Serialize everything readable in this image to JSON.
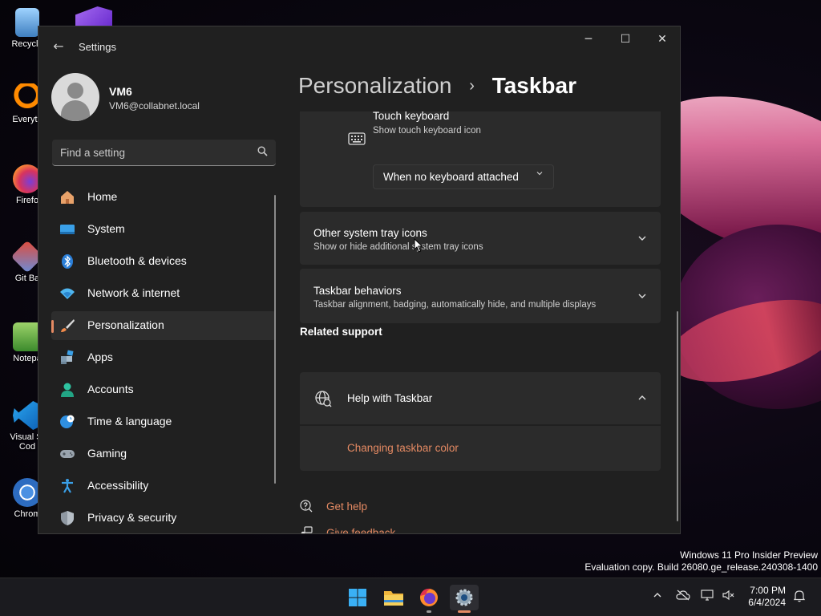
{
  "window": {
    "title": "Settings",
    "minimize": "─",
    "maximize": "☐",
    "close": "✕",
    "back_glyph": "←"
  },
  "profile": {
    "name": "VM6",
    "email": "VM6@collabnet.local"
  },
  "search": {
    "placeholder": "Find a setting",
    "value": ""
  },
  "nav": {
    "items": [
      {
        "label": "Home",
        "icon": "home-icon"
      },
      {
        "label": "System",
        "icon": "system-icon"
      },
      {
        "label": "Bluetooth & devices",
        "icon": "bluetooth-icon"
      },
      {
        "label": "Network & internet",
        "icon": "network-icon"
      },
      {
        "label": "Personalization",
        "icon": "brush-icon",
        "active": true
      },
      {
        "label": "Apps",
        "icon": "apps-icon"
      },
      {
        "label": "Accounts",
        "icon": "accounts-icon"
      },
      {
        "label": "Time & language",
        "icon": "globe-clock-icon"
      },
      {
        "label": "Gaming",
        "icon": "gamepad-icon"
      },
      {
        "label": "Accessibility",
        "icon": "accessibility-icon"
      },
      {
        "label": "Privacy & security",
        "icon": "shield-icon"
      }
    ]
  },
  "header": {
    "parent": "Personalization",
    "separator": "›",
    "current": "Taskbar"
  },
  "touch_keyboard": {
    "title": "Touch keyboard",
    "subtitle": "Show touch keyboard icon",
    "selected": "When no keyboard attached"
  },
  "tray_icons": {
    "title": "Other system tray icons",
    "subtitle": "Show or hide additional system tray icons"
  },
  "behaviors": {
    "title": "Taskbar behaviors",
    "subtitle": "Taskbar alignment, badging, automatically hide, and multiple displays"
  },
  "related": {
    "heading": "Related support",
    "help_title": "Help with Taskbar",
    "help_link": "Changing taskbar color"
  },
  "footer": {
    "get_help": "Get help",
    "give_feedback": "Give feedback"
  },
  "desktop": {
    "icons": [
      {
        "label": "Recycle"
      },
      {
        "label": "Everyth"
      },
      {
        "label": "Firefo"
      },
      {
        "label": "Git Ba"
      },
      {
        "label": "Notepa"
      },
      {
        "label": "Visual St Cod"
      },
      {
        "label": "Chrom"
      }
    ],
    "watermark_line1": "Windows 11 Pro Insider Preview",
    "watermark_line2": "Evaluation copy. Build 26080.ge_release.240308-1400"
  },
  "taskbar": {
    "time": "7:00 PM",
    "date": "6/4/2024",
    "apps": [
      "start-icon",
      "file-explorer-icon",
      "firefox-icon",
      "settings-icon"
    ]
  },
  "colors": {
    "accent": "#e58a63",
    "window_bg": "#202020",
    "card_bg": "#2b2b2b"
  }
}
